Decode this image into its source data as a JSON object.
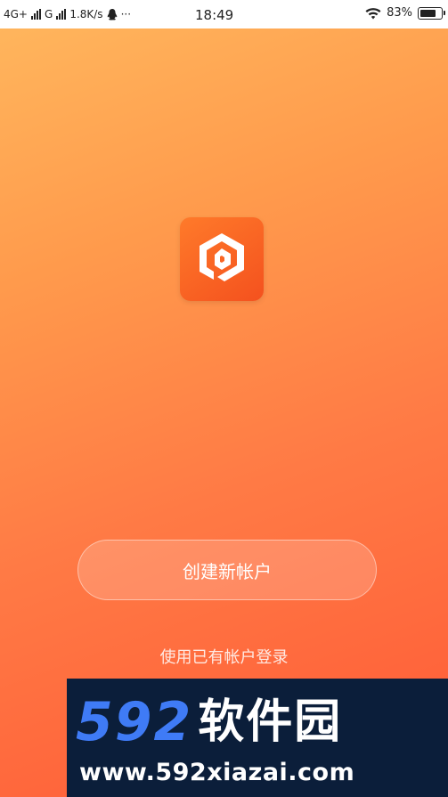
{
  "status_bar": {
    "network1": "4G+",
    "network2": "G",
    "speed": "1.8K/s",
    "extra": "···",
    "time": "18:49",
    "battery": "83%",
    "battery_level": 0.83
  },
  "app": {
    "logo_icon": "hexagon-spiral-logo-icon",
    "accent": "#f4511e"
  },
  "actions": {
    "create_account": "创建新帐户",
    "login_existing": "使用已有帐户登录"
  },
  "watermark": {
    "number": "592",
    "name": "软件园",
    "url": "www.592xiazai.com"
  }
}
